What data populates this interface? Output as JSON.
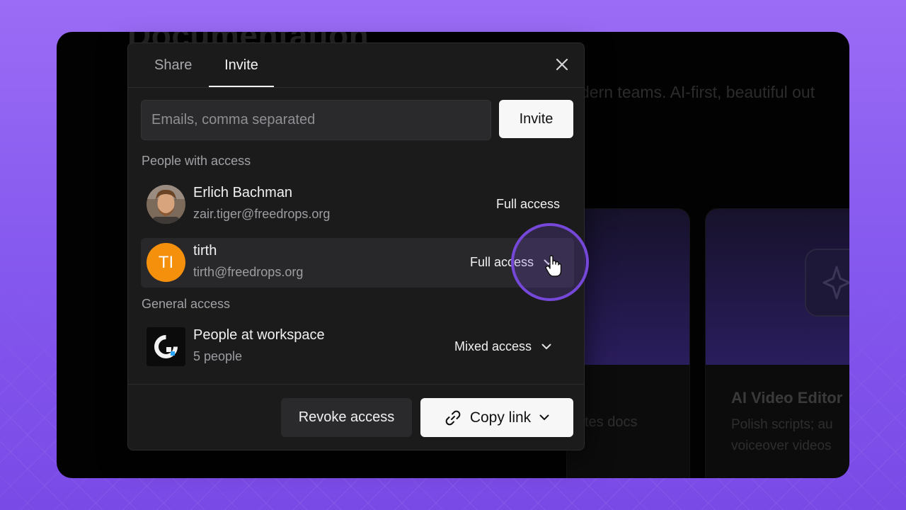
{
  "background_page": {
    "title": "Documentation",
    "subtitle": "dern teams. AI-first, beautiful out",
    "card_fragment": "tes docs",
    "card": {
      "title": "AI Video Editor",
      "desc_line1": "Polish scripts; au",
      "desc_line2": "voiceover videos"
    }
  },
  "modal": {
    "tabs": [
      {
        "label": "Share",
        "active": false
      },
      {
        "label": "Invite",
        "active": true
      }
    ],
    "close_icon": "close-icon",
    "email_input": {
      "placeholder": "Emails, comma separated",
      "value": ""
    },
    "invite_button": "Invite",
    "people_section_label": "People with access",
    "people": [
      {
        "name": "Erlich Bachman",
        "email": "zair.tiger@freedrops.org",
        "access": "Full access",
        "avatar": "photo"
      },
      {
        "name": "tirth",
        "email": "tirth@freedrops.org",
        "access": "Full access",
        "avatar_initials": "TI",
        "avatar_color": "#f5900c"
      }
    ],
    "general_section_label": "General access",
    "workspace": {
      "name": "People at workspace",
      "count": "5 people",
      "access": "Mixed access"
    },
    "footer": {
      "revoke_button": "Revoke access",
      "copy_link_button": "Copy link"
    }
  },
  "colors": {
    "accent_ring": "#7648d9",
    "avatar_orange": "#f5900c",
    "backdrop_purple": "#8b5cf6"
  }
}
